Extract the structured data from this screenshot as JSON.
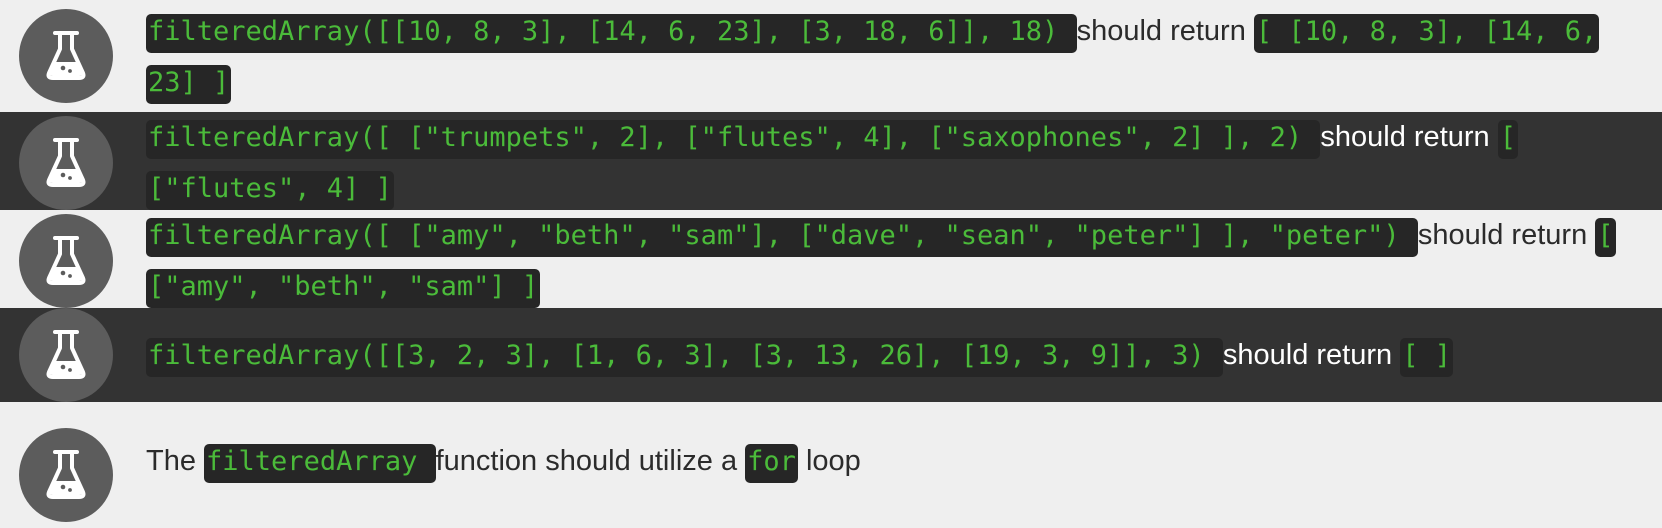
{
  "tests": [
    {
      "segments": [
        {
          "type": "code",
          "text": "filteredArray([[10, 8, 3], [14, 6, 23], [3, 18, 6]], 18) "
        },
        {
          "type": "text",
          "text": " should return "
        },
        {
          "type": "code",
          "text": "[ [10, 8, 3], [14, 6, 23] ]"
        }
      ]
    },
    {
      "segments": [
        {
          "type": "code",
          "text": "filteredArray([ [\"trumpets\", 2], [\"flutes\", 4], [\"saxophones\", 2] ], 2) "
        },
        {
          "type": "text",
          "text": " should return "
        },
        {
          "type": "code",
          "text": "[ [\"flutes\", 4] ] "
        }
      ]
    },
    {
      "segments": [
        {
          "type": "code",
          "text": "filteredArray([ [\"amy\", \"beth\", \"sam\"], [\"dave\", \"sean\", \"peter\"] ], \"peter\") "
        },
        {
          "type": "text",
          "text": " should return "
        },
        {
          "type": "code",
          "text": "[ [\"amy\", \"beth\", \"sam\"] ]"
        }
      ]
    },
    {
      "segments": [
        {
          "type": "code",
          "text": "filteredArray([[3, 2, 3], [1, 6, 3], [3, 13, 26], [19, 3, 9]], 3) "
        },
        {
          "type": "text",
          "text": " should return "
        },
        {
          "type": "code",
          "text": "[ ]"
        }
      ]
    },
    {
      "segments": [
        {
          "type": "text",
          "text": "The "
        },
        {
          "type": "code",
          "text": "filteredArray "
        },
        {
          "type": "text",
          "text": " function should utilize a "
        },
        {
          "type": "code",
          "text": "for"
        },
        {
          "type": "text",
          "text": " loop"
        }
      ]
    }
  ],
  "icon": "flask-icon"
}
